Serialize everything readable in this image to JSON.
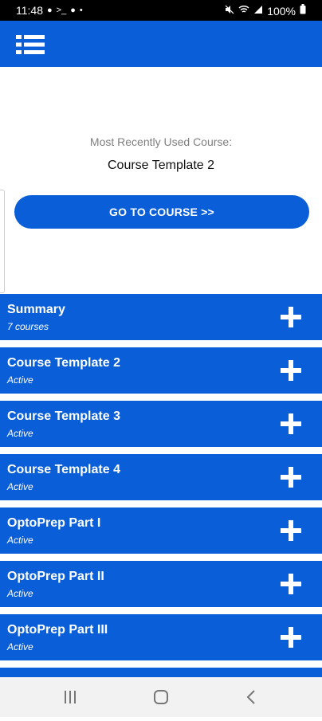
{
  "status_bar": {
    "time": "11:48",
    "battery": "100%",
    "icons": [
      "circle-icon",
      "terminal-icon",
      "circle-icon",
      "dot-icon",
      "mute-icon",
      "wifi-icon",
      "signal-icon",
      "battery-icon"
    ]
  },
  "app_bar": {
    "menu_icon": "list-menu-icon"
  },
  "recent": {
    "label": "Most Recently Used Course:",
    "course_name": "Course Template 2",
    "button_label": "GO TO COURSE >>"
  },
  "courses": [
    {
      "title": "Summary",
      "subtitle": "7 courses"
    },
    {
      "title": "Course Template 2",
      "subtitle": "Active"
    },
    {
      "title": "Course Template 3",
      "subtitle": "Active"
    },
    {
      "title": "Course Template 4",
      "subtitle": "Active"
    },
    {
      "title": "OptoPrep Part I",
      "subtitle": "Active"
    },
    {
      "title": "OptoPrep Part II",
      "subtitle": "Active"
    },
    {
      "title": "OptoPrep Part III",
      "subtitle": "Active"
    }
  ],
  "nav_bar": {
    "buttons": [
      "recents-icon",
      "home-icon",
      "back-icon"
    ]
  },
  "colors": {
    "primary": "#0a5fd8",
    "background": "#ffffff",
    "muted_text": "#7f7f7f",
    "nav_background": "#f2f2f2"
  }
}
